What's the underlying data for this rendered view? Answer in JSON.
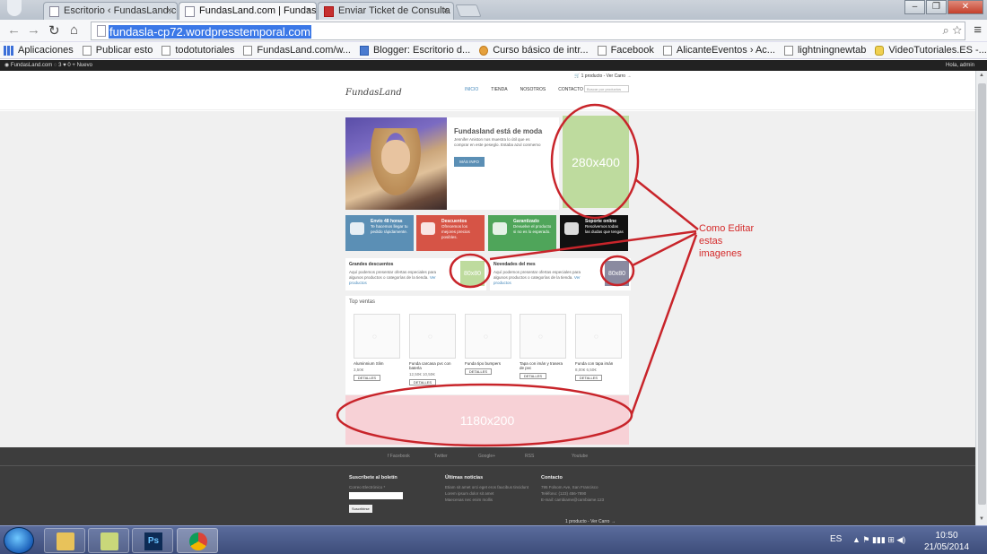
{
  "browser": {
    "tabs": [
      {
        "title": "Escritorio ‹ FundasLand.co",
        "active": false
      },
      {
        "title": "FundasLand.com | Fundas",
        "active": true
      },
      {
        "title": "Enviar Ticket de Consulta",
        "active": false
      }
    ],
    "url": "fundasla-cp72.wordpresstemporal.com",
    "bookmarks": [
      {
        "label": "Aplicaciones",
        "icon": "apps-grid-icon"
      },
      {
        "label": "Publicar esto",
        "icon": "page-icon"
      },
      {
        "label": "todotutoriales",
        "icon": "page-icon"
      },
      {
        "label": "FundasLand.com/w...",
        "icon": "page-icon"
      },
      {
        "label": "Blogger: Escritorio d...",
        "icon": "blogger-icon"
      },
      {
        "label": "Curso básico de intr...",
        "icon": "course-icon"
      },
      {
        "label": "Facebook",
        "icon": "page-icon"
      },
      {
        "label": "AlicanteEventos › Ac...",
        "icon": "page-icon"
      },
      {
        "label": "lightningnewtab",
        "icon": "page-icon"
      },
      {
        "label": "VideoTutoriales.ES -...",
        "icon": "video-icon"
      }
    ]
  },
  "adminbar": {
    "left": "◉ FundasLand.com  ◌ 3  ♥ 0  + Nuevo",
    "right": "Hola, admin"
  },
  "site": {
    "cart_top": "🛒 1 producto - Ver Carro →",
    "logo": "FundasLand",
    "nav": [
      "INICIO",
      "TIENDA",
      "NOSOTROS",
      "CONTACTO"
    ],
    "search_placeholder": "Buscar por productos",
    "slider": {
      "title": "Fundasland está de moda",
      "text": "Jennifer Aniston nos muestra lo útil que es comprar en este peseglo. Estaba azul conmemo",
      "button": "MÁS INFO"
    },
    "placeholder_large": "280x400",
    "features": [
      {
        "title": "Envío 48 horas",
        "text": "Te hacemos llegar tu pedido rápidamente.",
        "color": "#5b8fb5"
      },
      {
        "title": "Descuentos",
        "text": "Ofrecemos los mejores precios posibles.",
        "color": "#d65446"
      },
      {
        "title": "Garantizado",
        "text": "Devuelve el producto si no es lo esperado.",
        "color": "#4fa55a"
      },
      {
        "title": "Soporte online",
        "text": "Resolvemos todas las dudas que tengas",
        "color": "#111111"
      }
    ],
    "promos": [
      {
        "title": "Grandes descuentos",
        "text": "Aquí podemos presentar ofertas especiales para algunos productos o categorías de la tienda.",
        "link": "Ver productos",
        "thumb": "80x80",
        "thumb_color": "#bedb9e"
      },
      {
        "title": "Novedades del mes",
        "text": "Aquí podemos presentar ofertas especiales para algunos productos o categorías de la tienda.",
        "link": "Ver productos",
        "thumb": "80x80",
        "thumb_color": "#8a8aa0"
      }
    ],
    "top_ventas_title": "Top ventas",
    "products": [
      {
        "name": "Aluminnium Slim",
        "price": "3,50€",
        "button": "DETALLES"
      },
      {
        "name": "Funda carcasa pvc con baterla",
        "price": "12,50€ 10,50€",
        "button": "DETALLES"
      },
      {
        "name": "Funda tipo bumpers",
        "price": "",
        "button": "DETALLES"
      },
      {
        "name": "Tapa con imán y trasera de pvc",
        "price": "",
        "button": "DETALLES"
      },
      {
        "name": "Funda con tapa imán",
        "price": "8,00€ 6,50€",
        "button": "DETALLES"
      }
    ],
    "banner": "1180x200",
    "footer": {
      "social": [
        "f Facebook",
        "Twitter",
        "Google+",
        "RSS",
        "Youtube"
      ],
      "newsletter_title": "Suscríbete al boletín",
      "newsletter_label": "Correo Electrónico *",
      "newsletter_button": "Suscribirse",
      "news_title": "Últimas noticias",
      "news": [
        "Etiam sit amet orci eget eros faucibus tincidunt",
        "Lorem ipsum dolor sit amet",
        "Maecenas nec enim mollis"
      ],
      "contact_title": "Contacto",
      "contact": [
        "795 Folsom Ave, San Francisco",
        "Teléfono: (123) 456-7890",
        "E-mail: cambiame@cambiame.123"
      ],
      "cart": "1 producto - Ver Carro →"
    }
  },
  "annotation": {
    "text": "Como Editar estas imagenes",
    "color": "#d42a2a"
  },
  "taskbar": {
    "language": "ES",
    "time": "10:50",
    "date": "21/05/2014"
  }
}
